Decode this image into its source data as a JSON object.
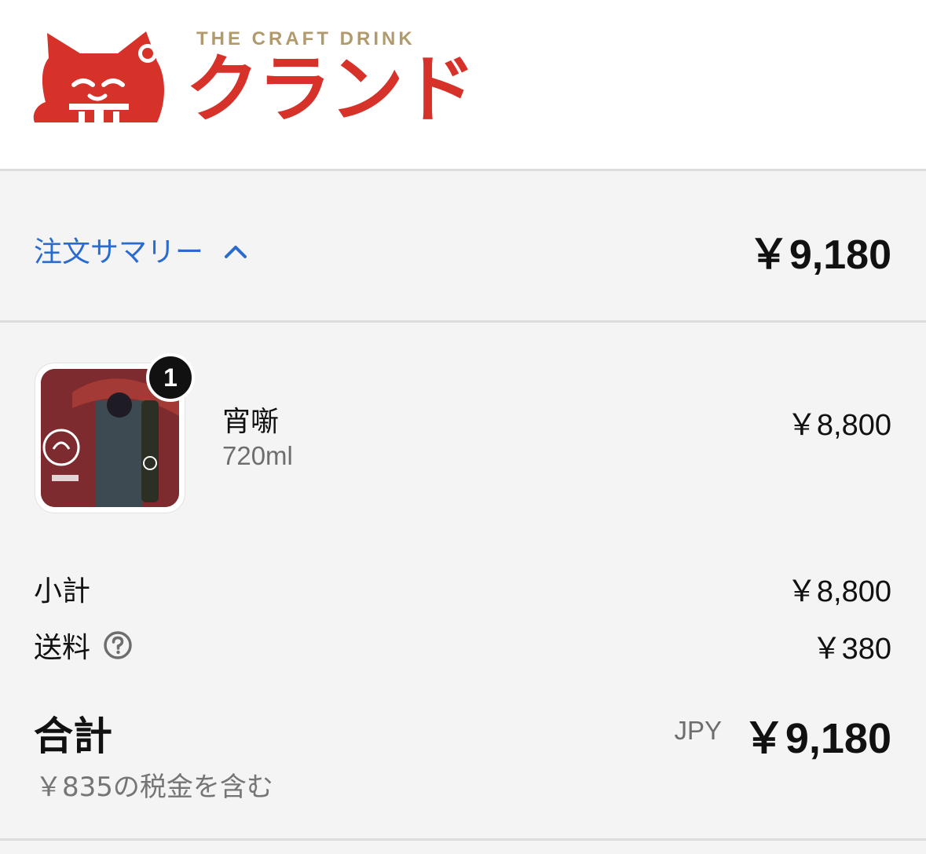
{
  "brand": {
    "tagline": "THE CRAFT DRINK",
    "name": "クランド",
    "logo_icon": "maneki-neko-cat-logo",
    "color": "#d6322a",
    "tagline_color": "#b09a6e"
  },
  "summary": {
    "toggle_label": "注文サマリー",
    "toggle_icon": "chevron-up-icon",
    "total": "￥9,180",
    "link_color": "#2a6bd0"
  },
  "line_items": [
    {
      "quantity": "1",
      "name": "宵噺",
      "variant": "720ml",
      "price": "￥8,800"
    }
  ],
  "totals": {
    "subtotal_label": "小計",
    "subtotal_value": "￥8,800",
    "shipping_label": "送料",
    "shipping_help_icon": "question-circle-icon",
    "shipping_value": "￥380",
    "total_label": "合計",
    "currency": "JPY",
    "total_value": "￥9,180",
    "tax_note": "￥835の税金を含む"
  }
}
